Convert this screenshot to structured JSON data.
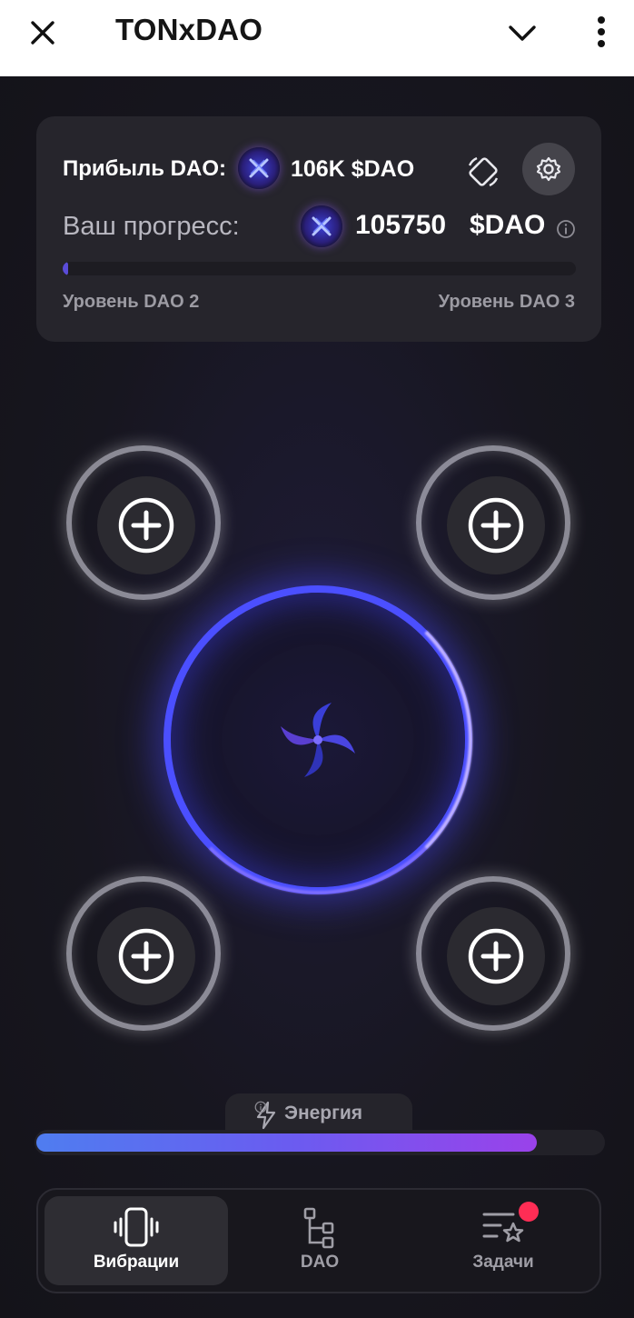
{
  "header": {
    "title": "TONxDAO",
    "icons": [
      "close-icon",
      "chevron-down-icon",
      "more-vertical-icon"
    ]
  },
  "card": {
    "profit_label": "Прибыль DAO:",
    "profit_value": "106K $DAO",
    "progress_label": "Ваш прогресс:",
    "progress_value": "105750",
    "progress_unit": "$DAO",
    "progress_fraction": 0.01,
    "level_current": "Уровень DAO 2",
    "level_next": "Уровень DAO 3",
    "icons": [
      "dao-coin-icon",
      "rotate-phone-icon",
      "gear-icon",
      "info-icon"
    ]
  },
  "slots": [
    "empty",
    "empty",
    "empty",
    "empty"
  ],
  "energy": {
    "label": "Энергия",
    "fraction": 0.88
  },
  "nav": {
    "items": [
      {
        "label": "Вибрации",
        "icon": "vibration-phone-icon",
        "active": true
      },
      {
        "label": "DAO",
        "icon": "hierarchy-icon",
        "active": false
      },
      {
        "label": "Задачи",
        "icon": "tasks-star-icon",
        "active": false,
        "badge": true
      }
    ]
  },
  "colors": {
    "accent": "#4b4fff",
    "energy_start": "#4f7df0",
    "energy_end": "#9a42ea",
    "badge": "#ff2d55",
    "background": "#17161f",
    "card": "#26252c"
  }
}
